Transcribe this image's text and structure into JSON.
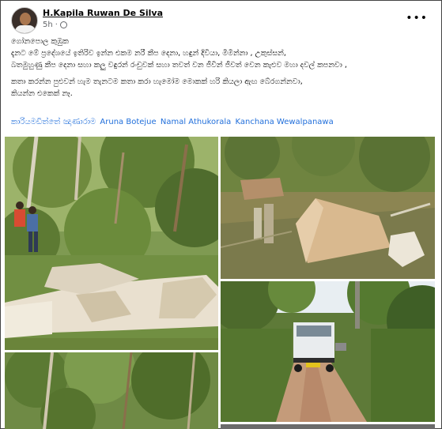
{
  "post": {
    "author": "H.Kapila Ruwan De Silva",
    "time": "5h",
    "lines": [
      "ගෝනපොල කුඹුක",
      "දැනට මේ ප්‍රදේශයේ ඉතිරිව ඉන්න එකම නරී කීප දෙනා, හඳුන් දිවියා, මීමින්නා , උකුස්සන්,",
      "බතමුහුණු කීප දෙනා සහා කලු වඳුරන් රංචුවක් සහා තවත් වන ජීවීන් ජීවත් වෙන කැළුව මහා දවල් කපනවා ,",
      "කතා කරන්න පුළුවන් හැම තැනටම කතා කරා හැමෝම මොකක් හරි කියලා ඇඟ බේරගන්නවා,",
      "කියන්න එකෙක් නෑ."
    ],
    "tags": [
      "කාරියමඩිත්තේ ඤාණාරාම",
      "Aruna Botejue",
      "Namal Athukorala",
      "Kanchana Wewalpanawa"
    ]
  },
  "icons": {
    "more": "more-options-icon",
    "audience": "globe-icon"
  },
  "colors": {
    "link": "#216fdb",
    "meta": "#65676b"
  }
}
